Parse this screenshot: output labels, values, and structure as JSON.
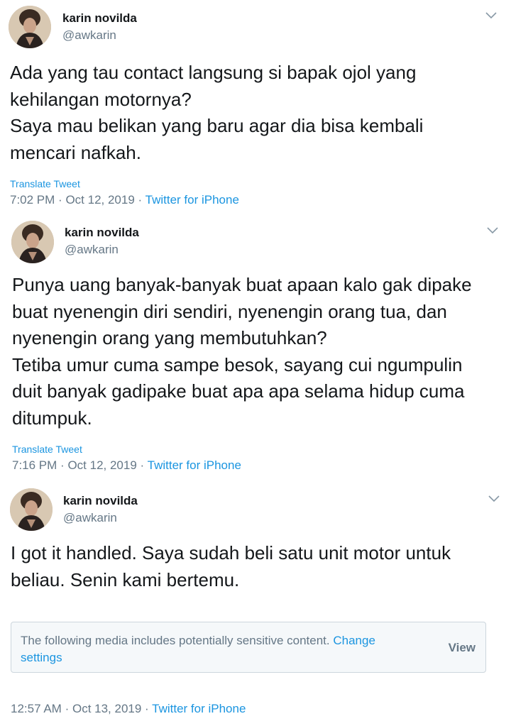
{
  "tweets": [
    {
      "name": "karin novilda",
      "handle": "@awkarin",
      "lines": [
        "Ada yang tau contact langsung si bapak ojol yang",
        "kehilangan motornya?",
        "Saya mau belikan yang baru agar dia bisa kembali",
        "mencari nafkah."
      ],
      "translate": "Translate Tweet",
      "time": "7:02 PM",
      "date": "Oct 12, 2019",
      "source": "Twitter for iPhone"
    },
    {
      "name": "karin novilda",
      "handle": "@awkarin",
      "lines": [
        "Punya uang banyak-banyak buat apaan kalo gak dipake",
        "buat nyenengin diri sendiri, nyenengin orang tua, dan",
        "nyenengin orang yang membutuhkan?",
        "Tetiba umur cuma sampe besok, sayang cui ngumpulin",
        "duit banyak gadipake buat apa apa selama hidup cuma",
        "ditumpuk."
      ],
      "translate": "Translate Tweet",
      "time": "7:16 PM",
      "date": "Oct 12, 2019",
      "source": "Twitter for iPhone"
    },
    {
      "name": "karin novilda",
      "handle": "@awkarin",
      "lines": [
        "I got it handled. Saya sudah beli satu unit motor untuk",
        "beliau. Senin kami bertemu."
      ],
      "time": "12:57 AM",
      "date": "Oct 13, 2019",
      "source": "Twitter for iPhone",
      "sensitive": {
        "message": "The following media includes potentially sensitive content.",
        "link": "Change settings",
        "view": "View"
      }
    }
  ],
  "separator": "·",
  "icons": {
    "caret": "chevron-down-icon",
    "avatar": "avatar"
  }
}
